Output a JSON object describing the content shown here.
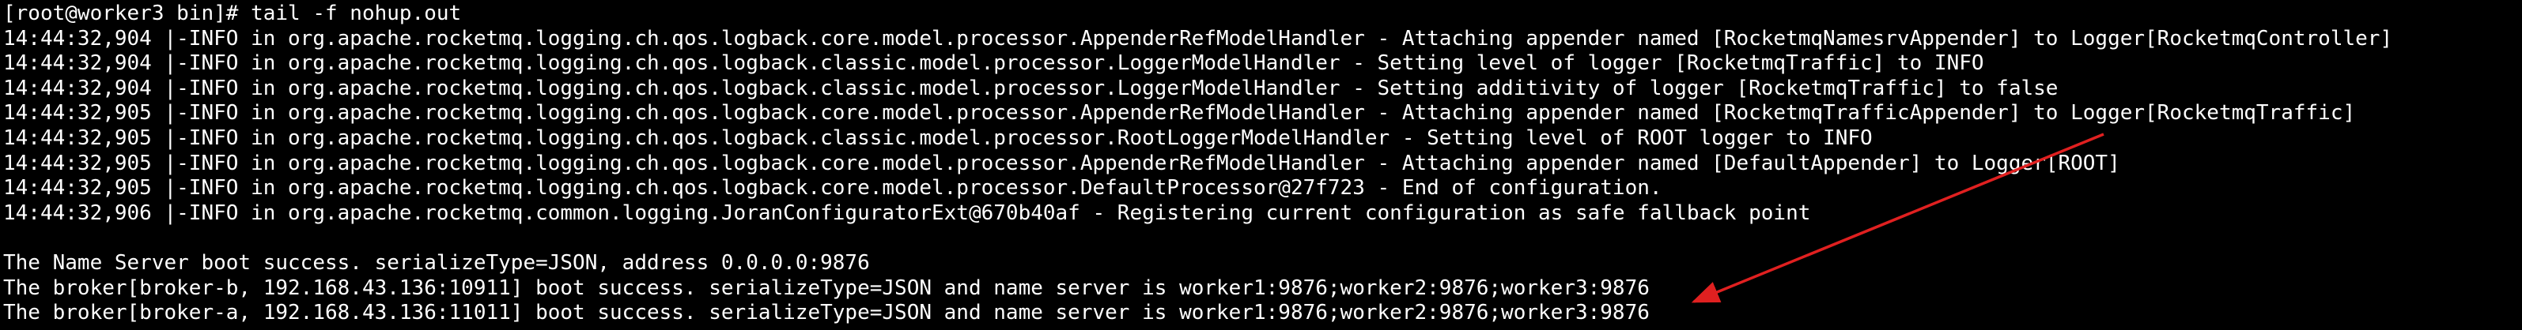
{
  "terminal": {
    "lines": [
      "[root@worker3 bin]# tail -f nohup.out",
      "14:44:32,904 |-INFO in org.apache.rocketmq.logging.ch.qos.logback.core.model.processor.AppenderRefModelHandler - Attaching appender named [RocketmqNamesrvAppender] to Logger[RocketmqController]",
      "14:44:32,904 |-INFO in org.apache.rocketmq.logging.ch.qos.logback.classic.model.processor.LoggerModelHandler - Setting level of logger [RocketmqTraffic] to INFO",
      "14:44:32,904 |-INFO in org.apache.rocketmq.logging.ch.qos.logback.classic.model.processor.LoggerModelHandler - Setting additivity of logger [RocketmqTraffic] to false",
      "14:44:32,905 |-INFO in org.apache.rocketmq.logging.ch.qos.logback.core.model.processor.AppenderRefModelHandler - Attaching appender named [RocketmqTrafficAppender] to Logger[RocketmqTraffic]",
      "14:44:32,905 |-INFO in org.apache.rocketmq.logging.ch.qos.logback.classic.model.processor.RootLoggerModelHandler - Setting level of ROOT logger to INFO",
      "14:44:32,905 |-INFO in org.apache.rocketmq.logging.ch.qos.logback.core.model.processor.AppenderRefModelHandler - Attaching appender named [DefaultAppender] to Logger[ROOT]",
      "14:44:32,905 |-INFO in org.apache.rocketmq.logging.ch.qos.logback.core.model.processor.DefaultProcessor@27f723 - End of configuration.",
      "14:44:32,906 |-INFO in org.apache.rocketmq.common.logging.JoranConfiguratorExt@670b40af - Registering current configuration as safe fallback point",
      "",
      "The Name Server boot success. serializeType=JSON, address 0.0.0.0:9876",
      "The broker[broker-b, 192.168.43.136:10911] boot success. serializeType=JSON and name server is worker1:9876;worker2:9876;worker3:9876",
      "The broker[broker-a, 192.168.43.136:11011] boot success. serializeType=JSON and name server is worker1:9876;worker2:9876;worker3:9876"
    ]
  },
  "colors": {
    "background": "#000000",
    "text": "#ffffff",
    "annotation_arrow": "#e02020"
  },
  "icons": {
    "annotation": "red-arrow-icon"
  }
}
